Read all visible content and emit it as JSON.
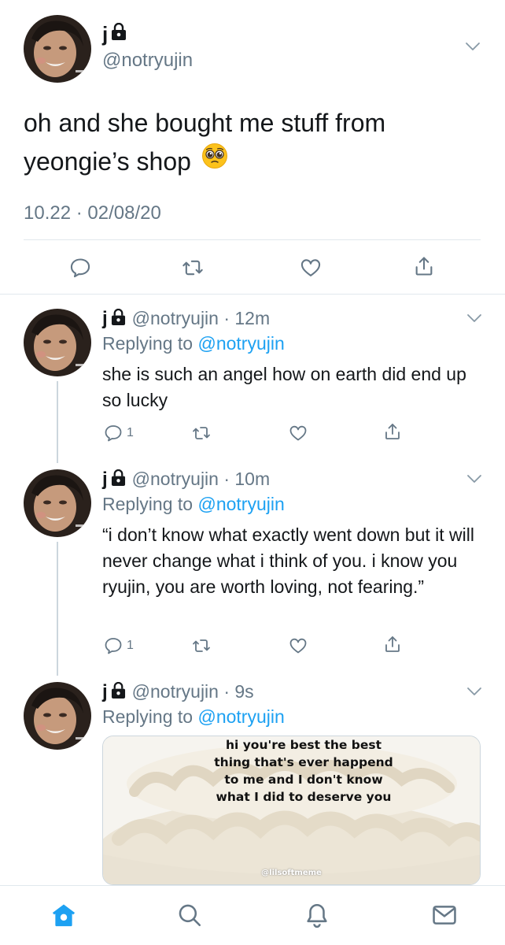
{
  "colors": {
    "accent": "#1da1f2",
    "secondary_text": "#657786",
    "divider": "#e1e8ed"
  },
  "main_tweet": {
    "display_name": "j",
    "handle": "@notryujin",
    "text": "oh and she bought me stuff from yeongie’s shop",
    "emoji": "pleading-face-emoji",
    "timestamp": "10.22 · 02/08/20",
    "actions": [
      "reply-icon",
      "retweet-icon",
      "like-icon",
      "share-icon"
    ]
  },
  "replies": [
    {
      "display_name": "j",
      "handle_time": "@notryujin · 12m",
      "replying_prefix": "Replying to ",
      "replying_handle": "@notryujin",
      "text": "she is such an angel how on earth did end up so lucky",
      "reply_count": "1"
    },
    {
      "display_name": "j",
      "handle_time": "@notryujin · 10m",
      "replying_prefix": "Replying to ",
      "replying_handle": "@notryujin",
      "text": "“i don’t know what exactly went down but it will never change what i think of you. i know you ryujin, you are worth loving, not fearing.”",
      "reply_count": "1"
    },
    {
      "display_name": "j",
      "handle_time": "@notryujin · 9s",
      "replying_prefix": "Replying to ",
      "replying_handle": "@notryujin",
      "media": {
        "caption_lines": [
          "hi you're best the best",
          "thing that's ever happend",
          "to me and I don't know",
          "what I did to deserve you"
        ],
        "watermark": "@lilsoftmeme"
      }
    }
  ],
  "tab_bar": [
    {
      "name": "home-icon",
      "active": true
    },
    {
      "name": "search-icon",
      "active": false
    },
    {
      "name": "notifications-icon",
      "active": false
    },
    {
      "name": "messages-icon",
      "active": false
    }
  ]
}
